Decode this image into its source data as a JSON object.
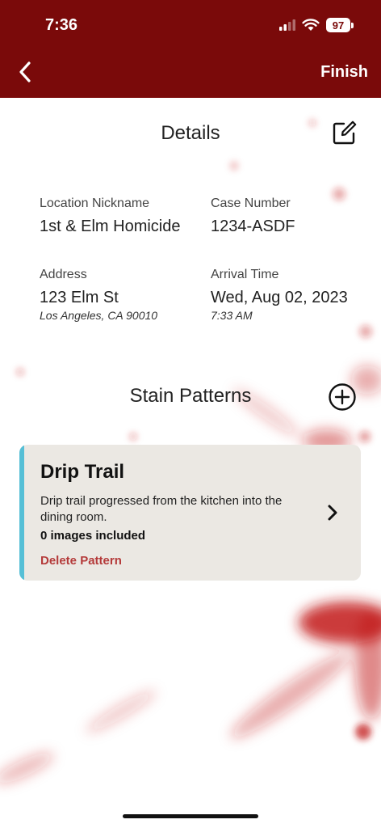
{
  "status_bar": {
    "time": "7:36",
    "battery": "97"
  },
  "nav": {
    "finish_label": "Finish"
  },
  "details": {
    "title": "Details",
    "location_nickname_label": "Location Nickname",
    "location_nickname": "1st & Elm Homicide",
    "case_number_label": "Case Number",
    "case_number": "1234-ASDF",
    "address_label": "Address",
    "address_line1": "123 Elm St",
    "address_line2": "Los Angeles, CA 90010",
    "arrival_time_label": "Arrival Time",
    "arrival_date": "Wed, Aug 02, 2023",
    "arrival_time": "7:33 AM"
  },
  "stain_patterns": {
    "title": "Stain Patterns",
    "items": [
      {
        "title": "Drip Trail",
        "description": "Drip trail progressed from the kitchen into the dining room.",
        "images_count": "0 images included",
        "delete_label": "Delete Pattern"
      }
    ]
  },
  "colors": {
    "header": "#7a0a0a",
    "accent": "#56bfd6",
    "delete": "#b43a3a",
    "card_bg": "#ebe8e3"
  }
}
